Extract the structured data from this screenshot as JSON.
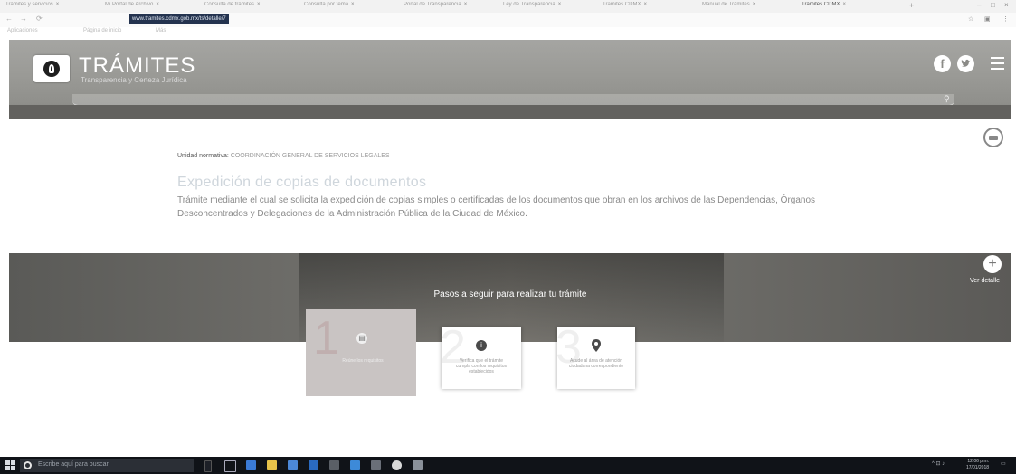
{
  "browser": {
    "tabs": [
      {
        "label": "Trámites y servicios"
      },
      {
        "label": "Mi Portal de Archivo"
      },
      {
        "label": "Consulta de trámites"
      },
      {
        "label": "Consulta por tema"
      },
      {
        "label": "Portal de Transparencia"
      },
      {
        "label": "Ley de Transparencia"
      },
      {
        "label": "Tramites CDMX"
      },
      {
        "label": "Manual de Trámites"
      },
      {
        "label": "Trámites CDMX"
      }
    ],
    "url": "www.tramites.cdmx.gob.mx/ts/detalle/7",
    "bookmarks": [
      "Aplicaciones",
      "Página de inicio",
      "Más"
    ]
  },
  "header": {
    "title": "TRÁMITES",
    "subtitle": "Transparencia y Certeza Jurídica"
  },
  "content": {
    "unit_label": "Unidad normativa:",
    "unit_value": "COORDINACIÓN GENERAL DE SERVICIOS LEGALES",
    "procedure_title": "Expedición de copias de documentos",
    "description": "Trámite mediante el cual se solicita la expedición de copias simples o certificadas de los documentos que obran en los archivos de las Dependencias, Órganos Desconcentrados y Delegaciones de la Administración Pública de la Ciudad de México."
  },
  "steps": {
    "heading": "Pasos a seguir para realizar tu trámite",
    "detail_label": "Ver detalle",
    "items": [
      {
        "number": "1",
        "icon": "document-icon",
        "text": "Reúne los requisitos"
      },
      {
        "number": "2",
        "icon": "info-icon",
        "text": "Verifica que el trámite cumpla con los requisitos establecidos"
      },
      {
        "number": "3",
        "icon": "location-pin-icon",
        "text": "Acude al área de atención ciudadana correspondiente"
      }
    ]
  },
  "taskbar": {
    "search_placeholder": "Escribe aquí para buscar",
    "time": "12:06 p.m.",
    "date": "17/01/2018"
  }
}
